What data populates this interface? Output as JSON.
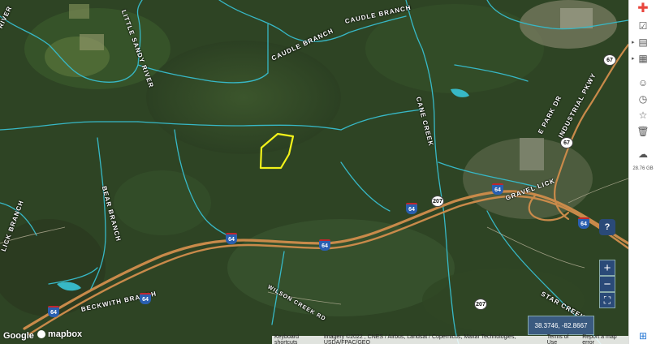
{
  "map": {
    "place_labels": {
      "little_sandy_river": "LITTLE SANDY RIVER",
      "river": "RIVER",
      "caudle_branch_1": "CAUDLE BRANCH",
      "caudle_branch_2": "CAUDLE BRANCH",
      "cane_creek": "CANE CREEK",
      "bear_branch": "BEAR BRANCH",
      "lick_branch": "LICK BRANCH",
      "beckwith_branch": "BECKWITH BRANCH",
      "gravel_lick": "GRAVEL LICK",
      "star_creek": "STAR CREEK",
      "industrial_pkwy": "INDUSTRIAL PKWY",
      "e_park_dr": "E PARK DR",
      "wilson_creek_rd": "WILSON CREEK RD"
    },
    "route_shields": {
      "i64_a": "64",
      "i64_b": "64",
      "i64_c": "64",
      "i64_d": "64",
      "i64_e": "64",
      "i64_f": "64",
      "i64_g": "64",
      "ky207_a": "207",
      "ky207_b": "207",
      "ky67_a": "67",
      "ky67_b": "67"
    },
    "colors": {
      "terrain": "#2d4425",
      "stream": "#37b8c6",
      "highway": "#c98a4a",
      "parcel_outline": "#f2f21a"
    }
  },
  "controls": {
    "zoom_in": "+",
    "zoom_out": "−",
    "fullscreen": "⛶",
    "help": "?",
    "coordinates": "38.3746, -82.8667"
  },
  "attribution": {
    "google": "Google",
    "mapbox": "mapbox",
    "keyboard_shortcuts": "Keyboard shortcuts",
    "imagery": "Imagery ©2022 , CNES / Airbus, Landsat / Copernicus, Maxar Technologies, USDA/FPAC/GEO",
    "terms": "Terms of Use",
    "report": "Report a map error"
  },
  "sidebar": {
    "storage": "28.76 GB"
  }
}
